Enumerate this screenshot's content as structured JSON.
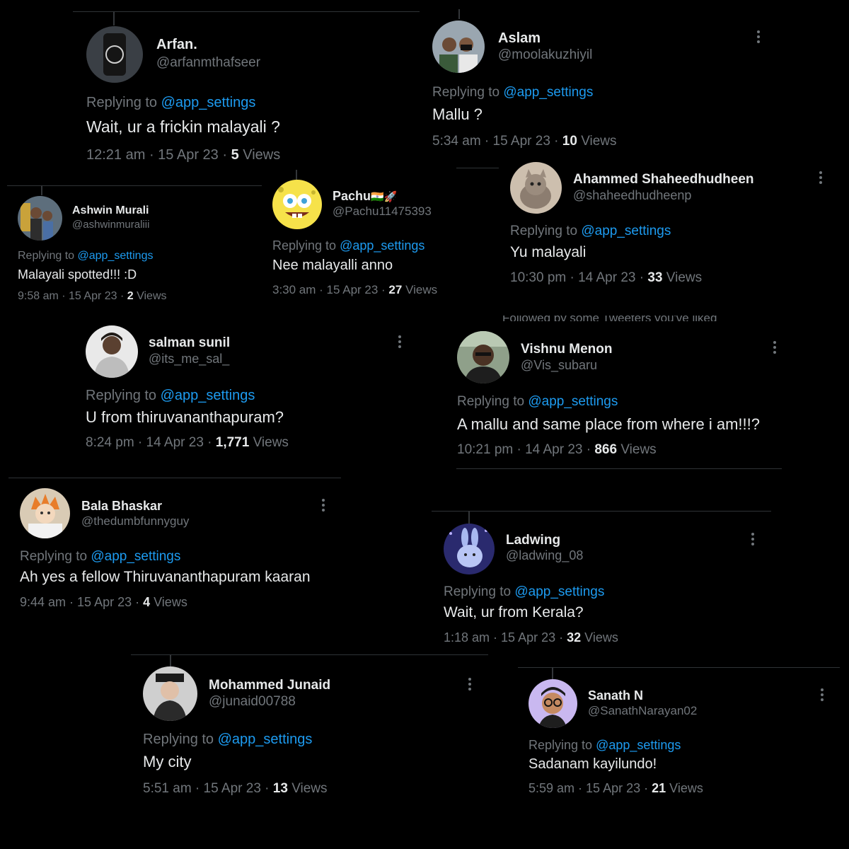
{
  "reply_prefix": "Replying to",
  "views_label": "Views",
  "clipped_note": "Followed by some Tweeters you've liked",
  "replies": [
    {
      "name": "Arfan.",
      "flag": "",
      "handle": "@arfanmthafseer",
      "mention": "@app_settings",
      "text": "Wait, ur a frickin malayali ?",
      "time": "12:21 am · 15 Apr 23 · ",
      "views": "5",
      "avatar_icon": "avatar-photo-icon"
    },
    {
      "name": "Aslam",
      "flag": "",
      "handle": "@moolakuzhiyil",
      "mention": "@app_settings",
      "text": "Mallu ?",
      "time": "5:34 am · 15 Apr 23 · ",
      "views": "10",
      "avatar_icon": "avatar-photo-icon"
    },
    {
      "name": "Ahammed Shaheedhudheen",
      "flag": "",
      "handle": "@shaheedhudheenp",
      "mention": "@app_settings",
      "text": "Yu malayali",
      "time": "10:30 pm · 14 Apr 23 · ",
      "views": "33",
      "avatar_icon": "cat-avatar-icon"
    },
    {
      "name": "Ashwin Murali",
      "flag": "",
      "handle": "@ashwinmuraliii",
      "mention": "@app_settings",
      "text": "Malayali spotted!!! :D",
      "time": "9:58 am · 15 Apr 23 · ",
      "views": "2",
      "avatar_icon": "avatar-photo-icon"
    },
    {
      "name": "Pachu",
      "flag": "🇮🇳🚀",
      "handle": "@Pachu11475393",
      "mention": "@app_settings",
      "text": "Nee malayalli anno",
      "time": "3:30 am · 15 Apr 23 · ",
      "views": "27",
      "avatar_icon": "spongebob-avatar-icon"
    },
    {
      "name": "salman sunil",
      "flag": "",
      "handle": "@its_me_sal_",
      "mention": "@app_settings",
      "text": "U from thiruvananthapuram?",
      "time": "8:24 pm · 14 Apr 23 · ",
      "views": "1,771",
      "avatar_icon": "avatar-photo-icon"
    },
    {
      "name": "Vishnu Menon",
      "flag": "",
      "handle": "@Vis_subaru",
      "mention": "@app_settings",
      "text": "A mallu and same place from where i am!!!?",
      "time": "10:21 pm · 14 Apr 23 · ",
      "views": "866",
      "avatar_icon": "avatar-photo-icon"
    },
    {
      "name": "Bala Bhaskar",
      "flag": "",
      "handle": "@thedumbfunnyguy",
      "mention": "@app_settings",
      "text": "Ah yes a fellow Thiruvananthapuram kaaran",
      "time": "9:44 am · 15 Apr 23 · ",
      "views": "4",
      "avatar_icon": "anime-avatar-icon"
    },
    {
      "name": "Ladwing",
      "flag": "",
      "handle": "@ladwing_08",
      "mention": "@app_settings",
      "text": "Wait, ur from Kerala?",
      "time": "1:18 am · 15 Apr 23 · ",
      "views": "32",
      "avatar_icon": "bunny-avatar-icon"
    },
    {
      "name": "Mohammed Junaid",
      "flag": "",
      "handle": "@junaid00788",
      "mention": "@app_settings",
      "text": "My city",
      "time": "5:51 am · 15 Apr 23 · ",
      "views": "13",
      "avatar_icon": "avatar-photo-icon"
    },
    {
      "name": "Sanath N",
      "flag": "",
      "handle": "@SanathNarayan02",
      "mention": "@app_settings",
      "text": "Sadanam kayilundo!",
      "time": "5:59 am · 15 Apr 23 · ",
      "views": "21",
      "avatar_icon": "memoji-avatar-icon"
    }
  ]
}
